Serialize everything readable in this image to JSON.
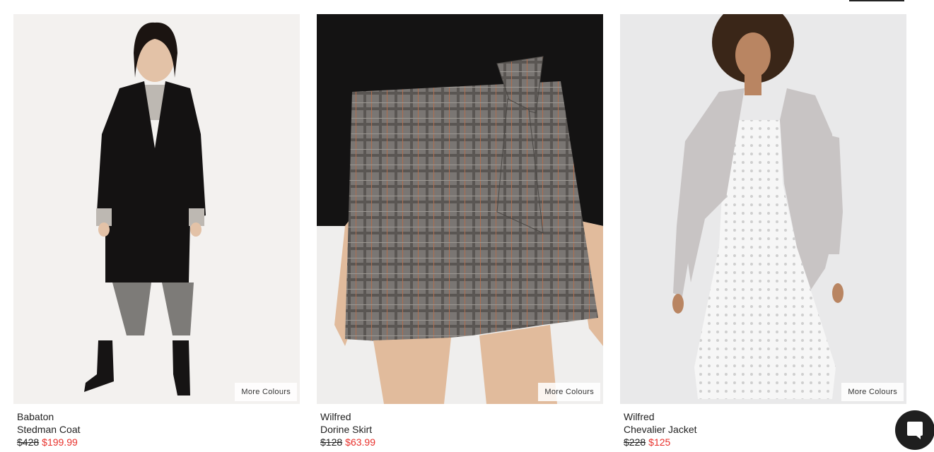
{
  "products": [
    {
      "brand": "Babaton",
      "name": "Stedman Coat",
      "original_price": "$428",
      "sale_price": "$199.99",
      "more_colours_label": "More Colours"
    },
    {
      "brand": "Wilfred",
      "name": "Dorine Skirt",
      "original_price": "$128",
      "sale_price": "$63.99",
      "more_colours_label": "More Colours"
    },
    {
      "brand": "Wilfred",
      "name": "Chevalier Jacket",
      "original_price": "$228",
      "sale_price": "$125",
      "more_colours_label": "More Colours"
    }
  ],
  "colors": {
    "sale": "#e8302b",
    "text": "#222222",
    "chat_button": "#1f1f1f"
  },
  "chat": {
    "icon": "chat-bubble-icon"
  }
}
